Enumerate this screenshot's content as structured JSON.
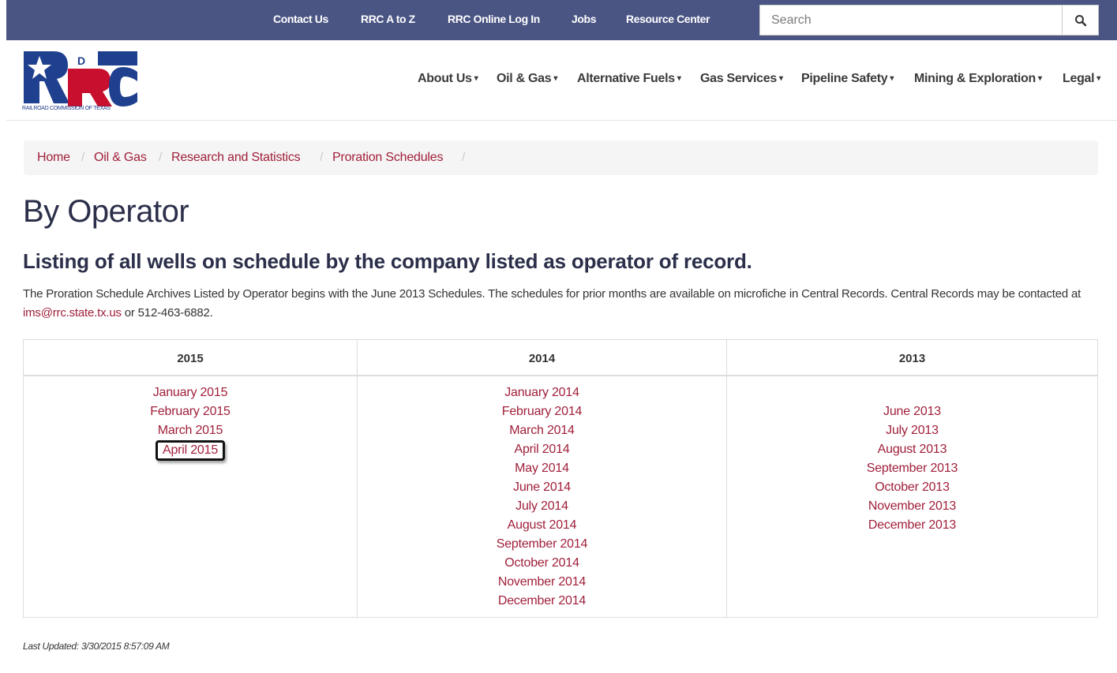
{
  "topbar": {
    "links": [
      "Contact Us",
      "RRC A to Z",
      "RRC Online Log In",
      "Jobs",
      "Resource Center"
    ],
    "search_placeholder": "Search",
    "background": "#4b5584"
  },
  "header": {
    "logo_caption": "RAILROAD COMMISSION OF TEXAS",
    "nav": [
      "About Us",
      "Oil & Gas",
      "Alternative Fuels",
      "Gas Services",
      "Pipeline Safety",
      "Mining & Exploration",
      "Legal"
    ],
    "nav_caret": "▾"
  },
  "breadcrumb": [
    "Home",
    "Oil & Gas",
    "Research and Statistics",
    "Proration Schedules"
  ],
  "breadcrumb_separator": "/",
  "page": {
    "title": "By Operator",
    "subtitle": "Listing of all wells on schedule by the company listed as operator of record.",
    "desc_before": "The Proration Schedule Archives Listed by Operator begins with the June 2013 Schedules. The schedules for prior months are available on microfiche in Central Records.  Central Records may be contacted at ",
    "desc_email": "ims@rrc.state.tx.us",
    "desc_after": " or 512-463-6882."
  },
  "schedule": {
    "columns": [
      {
        "year": "2015",
        "months": [
          "January 2015",
          "February 2015",
          "March 2015",
          "April 2015"
        ]
      },
      {
        "year": "2014",
        "months": [
          "January 2014",
          "February 2014",
          "March 2014",
          "April 2014",
          "May 2014",
          "June 2014",
          "July 2014",
          "August 2014",
          "September 2014",
          "October 2014",
          "November 2014",
          "December 2014"
        ]
      },
      {
        "year": "2013",
        "months": [
          "June 2013",
          "July 2013",
          "August 2013",
          "September 2013",
          "October 2013",
          "November 2013",
          "December 2013"
        ]
      }
    ],
    "highlighted": "April 2015"
  },
  "footer": {
    "last_updated": "Last Updated: 3/30/2015 8:57:09 AM"
  },
  "colors": {
    "link": "#a0203a",
    "heading": "#2b2f4a"
  },
  "icons": {
    "search": "search-icon",
    "logo": "rrc-logo"
  }
}
